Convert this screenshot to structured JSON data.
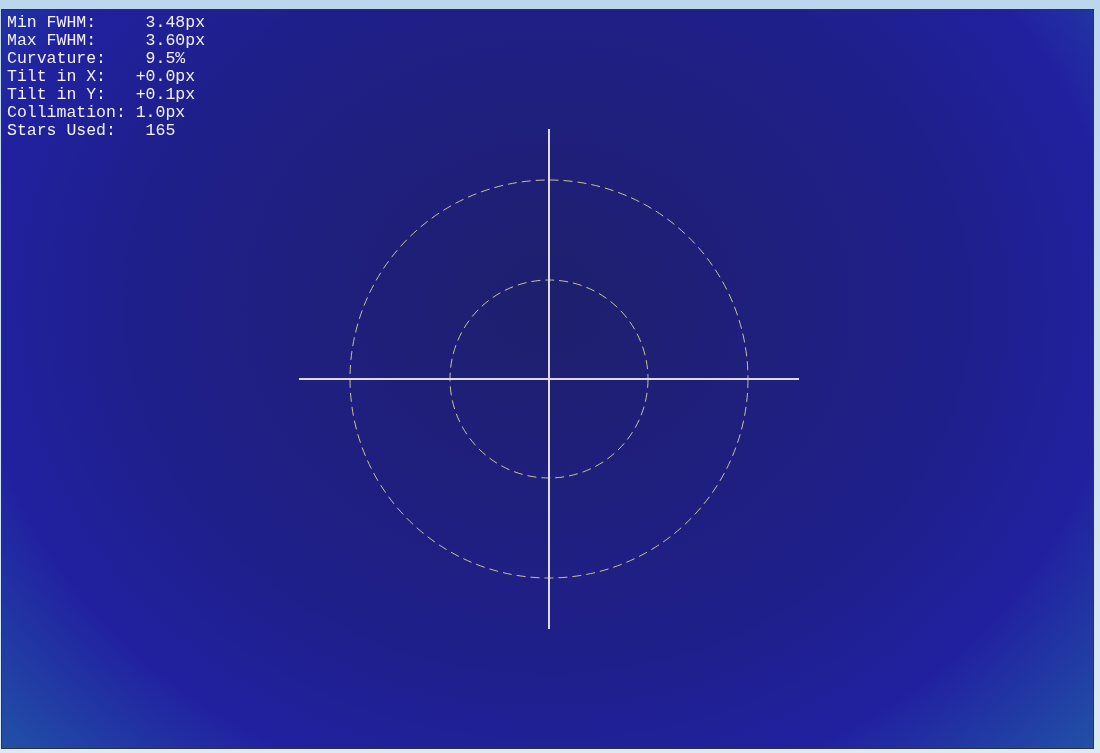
{
  "stats": [
    {
      "text": "Min FWHM:     3.48px"
    },
    {
      "text": "Max FWHM:     3.60px"
    },
    {
      "text": "Curvature:    9.5%"
    },
    {
      "text": "Tilt in X:   +0.0px"
    },
    {
      "text": "Tilt in Y:   +0.1px"
    },
    {
      "text": "Collimation: 1.0px"
    },
    {
      "text": "Stars Used:   165"
    }
  ]
}
